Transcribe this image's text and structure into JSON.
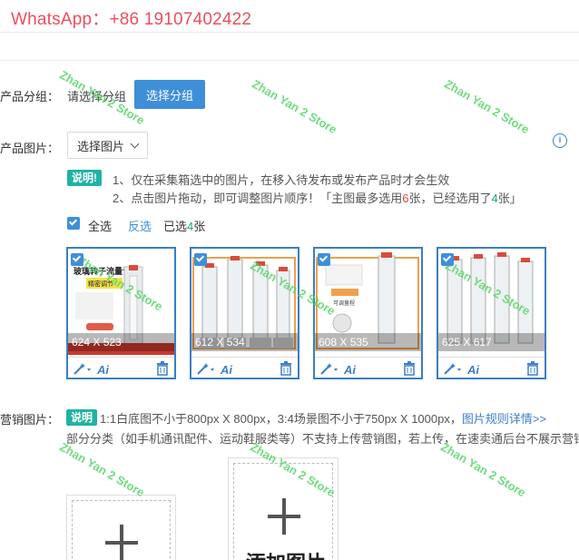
{
  "watermark_top": "WhatsApp：+86 19107402422",
  "watermark_diag": "Zhan Yan 2 Store",
  "category": {
    "label": "产品分组：",
    "placeholder": "请选择分组",
    "button": "选择分组"
  },
  "images": {
    "label": "产品图片：",
    "select_button": "选择图片",
    "tip_tag": "说明!",
    "tip1": "1、仅在采集箱选中的图片，在移入待发布或发布产品时才会生效",
    "tip2_prefix": "2、点击图片拖动，即可调整图片顺序！「主图最多选用",
    "tip2_max": "6",
    "tip2_mid": "张，已经选用了",
    "tip2_used": "4",
    "tip2_suffix": "张」",
    "select_all": "全选",
    "invert": "反选",
    "selected_prefix": "已选",
    "selected_count": "4",
    "selected_suffix": "张",
    "cards": [
      {
        "dims": "624 X 523",
        "title": "玻璃转子流量计",
        "subtitle": "精密调节"
      },
      {
        "dims": "612 X 534"
      },
      {
        "dims": "608 X 535",
        "inset": "可调量程"
      },
      {
        "dims": "625 X 617"
      }
    ]
  },
  "marketing": {
    "label": "营销图片：",
    "tag": "说明",
    "line1": "1:1白底图不小于800px X 800px，3:4场景图不小于750px X 1000px，",
    "link": "图片规则详情>>",
    "line2": "部分分类（如手机通讯配件、运动鞋服类等）不支持上传营销图，若上传，在速卖通后台不展示营销",
    "add_label": "添加图片"
  },
  "colors": {
    "primary": "#3f8fd8",
    "tag": "#1fb3a4",
    "accent_red": "#e8433f",
    "whatsapp": "#ea4f5e",
    "watermark": "#5bd56b"
  }
}
